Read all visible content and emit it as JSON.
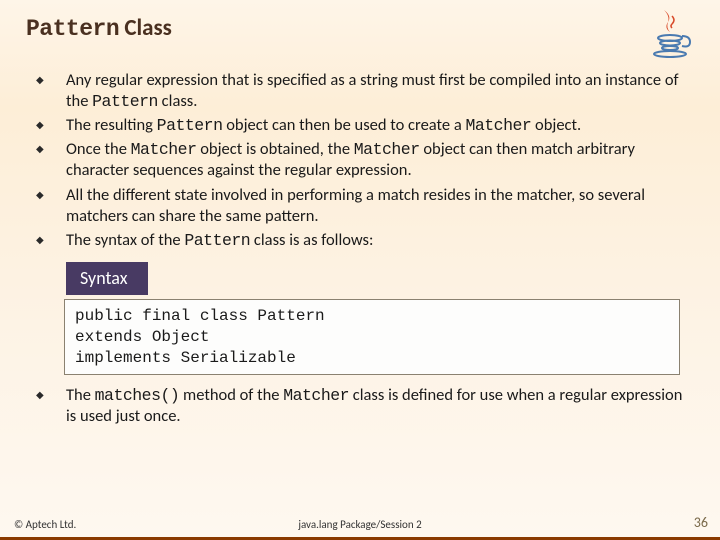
{
  "title_part1": "Pattern",
  "title_part2": " Class",
  "bullets_main": [
    {
      "pre": "Any regular expression that is specified as a string must first be compiled into an instance of the ",
      "code": "Pattern",
      "post": " class."
    },
    {
      "pre": "The resulting ",
      "code": "Pattern",
      "mid": " object can then be used to create a ",
      "code2": "Matcher",
      "post": " object."
    },
    {
      "pre": "Once the ",
      "code": "Matcher",
      "mid": " object is obtained, the ",
      "code2": "Matcher",
      "post": " object can then match arbitrary character sequences against the regular expression."
    },
    {
      "pre": "All the different state involved in performing a match resides in the matcher, so several matchers can share the same pattern.",
      "code": "",
      "post": ""
    },
    {
      "pre": "The syntax of the ",
      "code": "Pattern",
      "post": " class is as follows:"
    }
  ],
  "syntax_label": "Syntax",
  "syntax_code": "public final class Pattern\nextends Object\nimplements Serializable",
  "bullets_after": [
    {
      "pre": "The ",
      "code": "matches()",
      "mid": "  method of the ",
      "code2": "Matcher",
      "post": " class is defined for use when a regular expression is used just once."
    }
  ],
  "footer": {
    "left": "© Aptech Ltd.",
    "center": "java.lang Package/Session 2",
    "right": "36"
  }
}
